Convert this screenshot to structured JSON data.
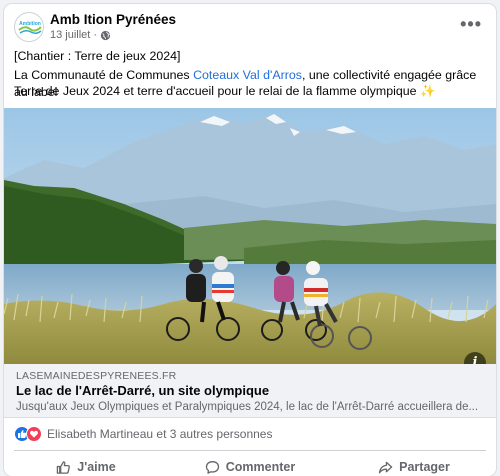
{
  "post": {
    "page_name": "Amb Ition Pyrénées",
    "date": "13 juillet",
    "separator": "·",
    "avatar_text": "Ambition Pyrénées",
    "line1": "[Chantier  : Terre de jeux 2024]",
    "line2_prefix": "La Communauté de Communes ",
    "line2_link": "Coteaux Val d'Arros",
    "line2_suffix": ", une collectivité engagée grâce au label",
    "line3": "Terre de Jeux 2024 et terre d'accueil pour le relai de la flamme olympique ✨",
    "more_label": "•••"
  },
  "link_preview": {
    "domain": "LASEMAINEDESPYRENEES.FR",
    "title": "Le lac de l'Arrêt-Darré, un site olympique",
    "description": "Jusqu'aux Jeux Olympiques et Paralympiques 2024, le lac de l'Arrêt-Darré accueillera de...",
    "info_label": "i"
  },
  "reactions": {
    "text": "Elisabeth Martineau et 3 autres personnes"
  },
  "actions": [
    {
      "label": "J'aime",
      "icon": "thumb-up-icon"
    },
    {
      "label": "Commenter",
      "icon": "comment-icon"
    },
    {
      "label": "Partager",
      "icon": "share-icon"
    }
  ],
  "colors": {
    "link": "#216fdb",
    "like": "#1b74e4",
    "love": "#f33e58",
    "secondary_text": "#65676b"
  }
}
